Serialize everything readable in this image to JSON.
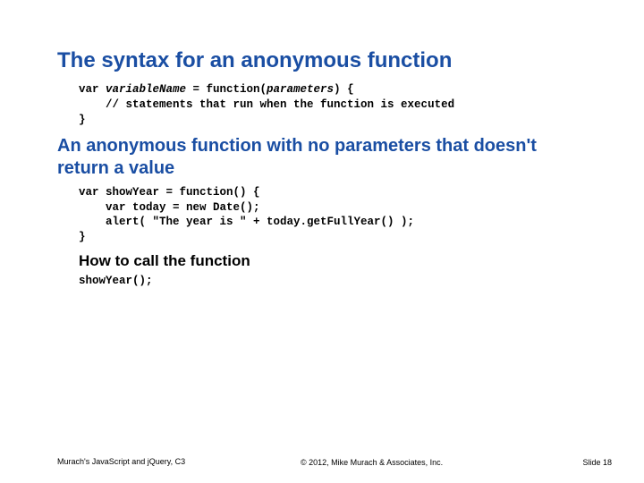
{
  "title": "The syntax for an anonymous function",
  "code_syntax_l1_a": "var ",
  "code_syntax_l1_b": "variableName",
  "code_syntax_l1_c": " = function(",
  "code_syntax_l1_d": "parameters",
  "code_syntax_l1_e": ") {",
  "code_syntax_l2": "    // statements that run when the function is executed",
  "code_syntax_l3": "}",
  "heading_noparams": "An anonymous function with no parameters that doesn't return a value",
  "code_ex_l1": "var showYear = function() {",
  "code_ex_l2": "    var today = new Date();",
  "code_ex_l3": "    alert( \"The year is \" + today.getFullYear() );",
  "code_ex_l4": "}",
  "heading_call": "How to call the function",
  "code_call": "showYear();",
  "footer": {
    "left": "Murach's JavaScript and jQuery, C3",
    "mid": "© 2012, Mike Murach & Associates, Inc.",
    "right": "Slide 18"
  }
}
